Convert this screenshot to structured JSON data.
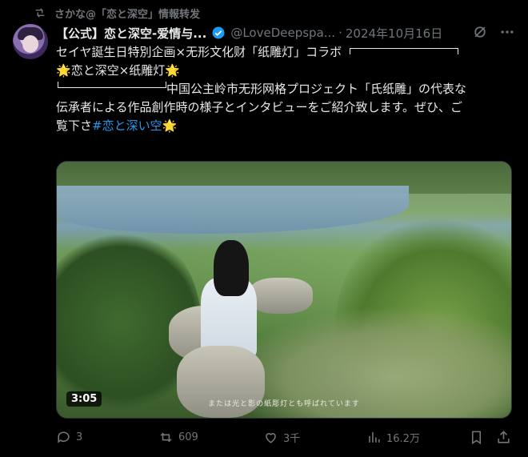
{
  "retweet": {
    "icon": "retweet-icon",
    "text": "さかな@「恋と深空」情報转发"
  },
  "author": {
    "name": "【公式】恋と深空-爱情与...",
    "handle": "@LoveDeepspa...",
    "separator": "·",
    "date": "2024年10月16日",
    "verified": true
  },
  "tweet": {
    "line1": "セイヤ誕生日特別企画×无形文化财「纸雕灯」コラボ",
    "line2_star1": "🌟",
    "line2_text": "恋と深空×纸雕灯",
    "line2_star2": "🌟",
    "line3": "中国公主岭市无形网格プロジェクト「氏纸雕」の代表な",
    "line4": "伝承者による作品創作時の様子とインタビューをご紹介致します。ぜひ、ご",
    "line5_text": "覧下さ",
    "line5_hashtag": "#恋と深い空",
    "line5_star": "🌟"
  },
  "media": {
    "subtitle": "または光と影の紙彫灯とも呼ばれています",
    "duration": "3:05"
  },
  "actions": {
    "reply_count": "3",
    "retweet_count": "609",
    "like_count": "3千",
    "view_count": "16.2万"
  },
  "colors": {
    "background": "#000000",
    "text": "#e7e9ea",
    "muted": "#71767b",
    "link": "#1d9bf0",
    "verified": "#1d9bf0"
  }
}
